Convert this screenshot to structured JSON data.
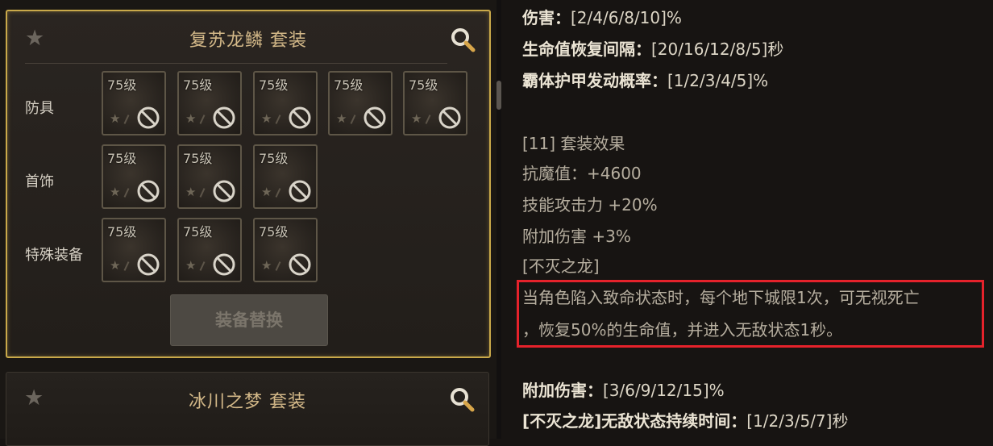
{
  "sets": [
    {
      "title": "复苏龙鳞  套装",
      "rows": [
        {
          "label": "防具",
          "slots": [
            "75级",
            "75级",
            "75级",
            "75级",
            "75级"
          ]
        },
        {
          "label": "首饰",
          "slots": [
            "75级",
            "75级",
            "75级"
          ]
        },
        {
          "label": "特殊装备",
          "slots": [
            "75级",
            "75级",
            "75级"
          ]
        }
      ],
      "swap_button": "装备替换"
    },
    {
      "title": "冰川之梦  套装"
    }
  ],
  "description": {
    "lines": [
      {
        "prefix": "伤害：",
        "value": "[2/4/6/8/10]%"
      },
      {
        "prefix": "生命值恢复间隔：",
        "value": "[20/16/12/8/5]秒"
      },
      {
        "prefix": "霸体护甲发动概率：",
        "value": "[1/2/3/4/5]%"
      }
    ],
    "set_effect_header": "[11] 套装效果",
    "effects": [
      "抗魔值：+4600",
      "技能攻击力 +20%",
      "附加伤害 +3%",
      "[不灭之龙]"
    ],
    "highlight_lines": [
      "当角色陷入致命状态时，每个地下城限1次，可无视死亡",
      "，恢复50%的生命值，并进入无敌状态1秒。"
    ],
    "bottom_lines": [
      {
        "prefix": "附加伤害：",
        "value": "[3/6/9/12/15]%"
      },
      {
        "prefix": "[不灭之龙]无敌状态持续时间：",
        "value": "[1/2/3/5/7]秒"
      }
    ]
  },
  "colors": {
    "card_border": "#c9a94a",
    "title_text": "#d3b888",
    "highlight_border": "#e5222b"
  }
}
